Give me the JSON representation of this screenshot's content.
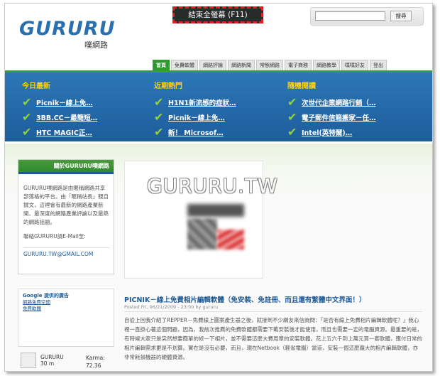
{
  "brand": {
    "logo": "GURURU",
    "sub": "噗網路"
  },
  "fullscreen": {
    "label": "結束全螢幕 (F11)"
  },
  "search": {
    "placeholder": "",
    "button": "搜尋"
  },
  "nav": {
    "tabs": [
      "首頁",
      "免費軟體",
      "網路評論",
      "網路新聞",
      "常態網路",
      "電子商務",
      "網路教學",
      "噗噗好友",
      "登出"
    ]
  },
  "columns": [
    {
      "title": "今日最新",
      "items": [
        "Picnik－線上免…",
        "3BB.CC－最簡短…",
        "HTC MAGIC正…"
      ]
    },
    {
      "title": "近期熱門",
      "items": [
        "H1N1新流感的症狀…",
        "Picnik－線上免…",
        "新！ Microsof…"
      ]
    },
    {
      "title": "隨機閱讀",
      "items": [
        "次世代企業網路行銷（…",
        "電子郵件信箱搬家－任…",
        "Intel(英特爾)…"
      ]
    }
  ],
  "about": {
    "title": "關於GURURU噗網路",
    "body": "GURURU噗網路是由暱稱網路共享部落格的平台。由「暱稱站長」親自撰文，這裡會有最新的網路產業新聞、最深度的網路產業評論以及最熱的網路話題。",
    "contact": "聯絡GURURU請E-Mail至:",
    "email": "GURURU.TW@GMAIL.COM"
  },
  "ads": {
    "title": "Google 提供的廣告",
    "links": [
      "網路免費空間",
      "免費軟體"
    ]
  },
  "profile": {
    "name": "GURURU",
    "handle": "30 m",
    "karma_label": "Karma:",
    "karma_value": "72.36"
  },
  "watermark": "GURURU.TW",
  "post": {
    "title": "PICNIK－線上免費相片編輯軟體（免安裝、免註冊、而且還有繁體中文界面！）",
    "meta": "Posted Fri, 06/21/2009 - 23:00 by gururu",
    "body": "自從上回我介紹了REPPER－免費線上圖案產生器之後，就接到不少網友來信詢問：「是否有線上免費相片編輯軟體呢？」我心裡一直掛心著這個問題，因為，我前次推薦的免費軟體都需要下載安裝後才能使用，而且也需要一定的電腦資源。最重要的是，有時候大家只是突然想要簡單的修一下相片，並不需要這麼大費周章的安裝軟體。花上五六千到上萬元買一套軟體，應付日常的相片編輯需求更是不划算。實在是沒有必要，而且，現在Netbook（輕省電腦）當道，安裝一個這麼龐大的相片編輯軟體，亦非常耗損機器的硬體資源。"
  }
}
